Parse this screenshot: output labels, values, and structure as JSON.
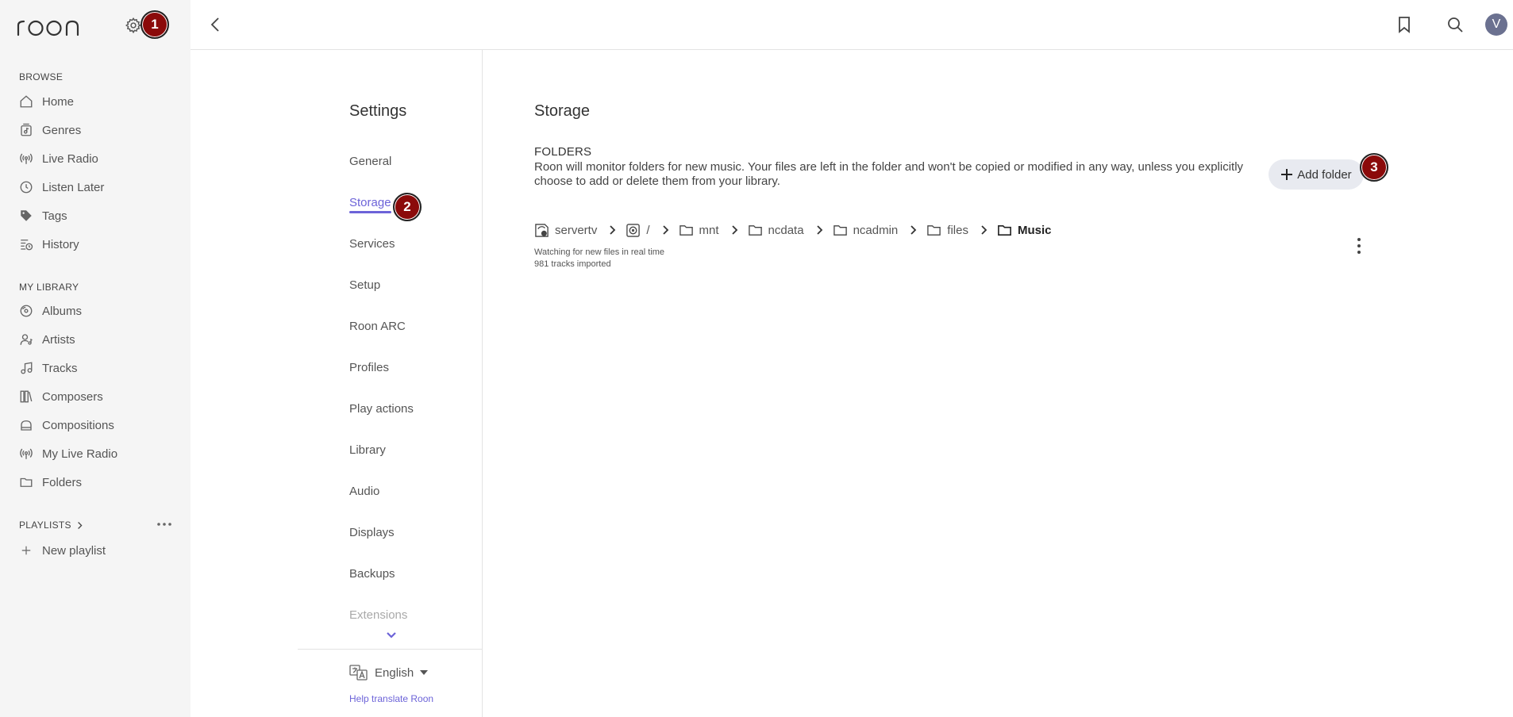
{
  "colors": {
    "accent": "#6c63d8",
    "sidebar_bg": "#f5f5f5",
    "badge_bg": "#8b0a0a",
    "avatar_bg": "#6b7190",
    "add_folder_bg": "#e8eaf0"
  },
  "app": {
    "logo_text": "roon",
    "avatar_letter": "V"
  },
  "sidebar": {
    "browse_label": "BROWSE",
    "browse_items": [
      {
        "label": "Home",
        "icon": "home-icon"
      },
      {
        "label": "Genres",
        "icon": "genres-icon"
      },
      {
        "label": "Live Radio",
        "icon": "radio-icon"
      },
      {
        "label": "Listen Later",
        "icon": "clock-icon"
      },
      {
        "label": "Tags",
        "icon": "tag-icon"
      },
      {
        "label": "History",
        "icon": "history-icon"
      }
    ],
    "library_label": "MY LIBRARY",
    "library_items": [
      {
        "label": "Albums",
        "icon": "album-icon"
      },
      {
        "label": "Artists",
        "icon": "artist-icon"
      },
      {
        "label": "Tracks",
        "icon": "music-note-icon"
      },
      {
        "label": "Composers",
        "icon": "composer-icon"
      },
      {
        "label": "Compositions",
        "icon": "composition-icon"
      },
      {
        "label": "My Live Radio",
        "icon": "radio-icon"
      },
      {
        "label": "Folders",
        "icon": "folder-icon"
      }
    ],
    "playlists_label": "PLAYLISTS",
    "new_playlist_label": "New playlist"
  },
  "settings_nav": {
    "title": "Settings",
    "items": [
      {
        "label": "General"
      },
      {
        "label": "Storage"
      },
      {
        "label": "Services"
      },
      {
        "label": "Setup"
      },
      {
        "label": "Roon ARC"
      },
      {
        "label": "Profiles"
      },
      {
        "label": "Play actions"
      },
      {
        "label": "Library"
      },
      {
        "label": "Audio"
      },
      {
        "label": "Displays"
      },
      {
        "label": "Backups"
      },
      {
        "label": "Extensions"
      }
    ],
    "active": "Storage",
    "language": "English",
    "help_translate": "Help translate Roon"
  },
  "storage": {
    "title": "Storage",
    "folders_heading": "FOLDERS",
    "folders_description": "Roon will monitor folders for new music. Your files are left in the folder and won't be copied or modified in any way, unless you explicitly choose to add or delete them from your library.",
    "add_folder_label": "Add folder",
    "path": [
      "servertv",
      "/",
      "mnt",
      "ncdata",
      "ncadmin",
      "files",
      "Music"
    ],
    "status_line1": "Watching for new files in real time",
    "status_line2": "981 tracks imported"
  },
  "annotations": [
    "1",
    "2",
    "3"
  ]
}
